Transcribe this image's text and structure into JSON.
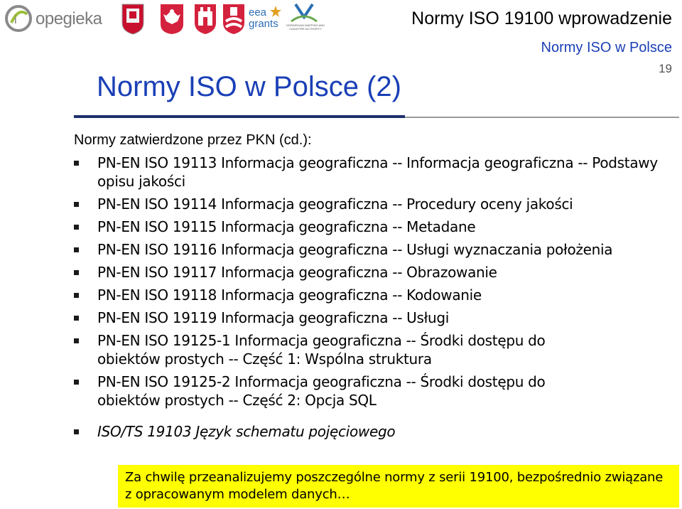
{
  "header": {
    "opegieka_logo": "opegieka",
    "eea_line1": "eea",
    "eea_line2": "grants",
    "nmca_text": "NORWEGIAN MAPPING AND CADASTRE AUTHORITY",
    "title": "Normy ISO 19100 wprowadzenie"
  },
  "slide": {
    "subtitle": "Normy ISO w Polsce",
    "page_number": "19",
    "title": "Normy ISO w Polsce (2)",
    "intro": "Normy zatwierdzone przez PKN (cd.):",
    "items": [
      {
        "text": "PN-EN ISO 19113 Informacja geograficzna -- Informacja geograficzna -- Podstawy opisu jakości",
        "italic": false
      },
      {
        "text": "PN-EN ISO 19114 Informacja geograficzna -- Procedury oceny jakości",
        "italic": false
      },
      {
        "text": "PN-EN ISO 19115 Informacja geograficzna -- Metadane",
        "italic": false
      },
      {
        "text": "PN-EN ISO 19116 Informacja geograficzna -- Usługi wyznaczania położenia",
        "italic": false
      },
      {
        "text": "PN-EN ISO 19117 Informacja geograficzna -- Obrazowanie",
        "italic": false
      },
      {
        "text": "PN-EN ISO 19118 Informacja geograficzna -- Kodowanie",
        "italic": false
      },
      {
        "text": "PN-EN ISO 19119 Informacja geograficzna -- Usługi",
        "italic": false
      },
      {
        "text": "PN-EN ISO 19125-1 Informacja geograficzna -- Środki dostępu do obiektów prostych -- Część 1: Wspólna struktura",
        "italic": false
      },
      {
        "text": "PN-EN ISO 19125-2 Informacja geograficzna -- Środki dostępu do obiektów prostych -- Część 2: Opcja SQL",
        "italic": false
      },
      {
        "text": "ISO/TS 19103 Język schematu pojęciowego",
        "italic": true
      }
    ],
    "note": "Za chwilę przeanalizujemy poszczególne normy z serii 19100, bezpośrednio związane z opracowanym modelem danych…"
  },
  "colors": {
    "title_blue": "#1a3fb6",
    "note_background": "#ffff00",
    "rule_dark": "#1f2f6e"
  }
}
